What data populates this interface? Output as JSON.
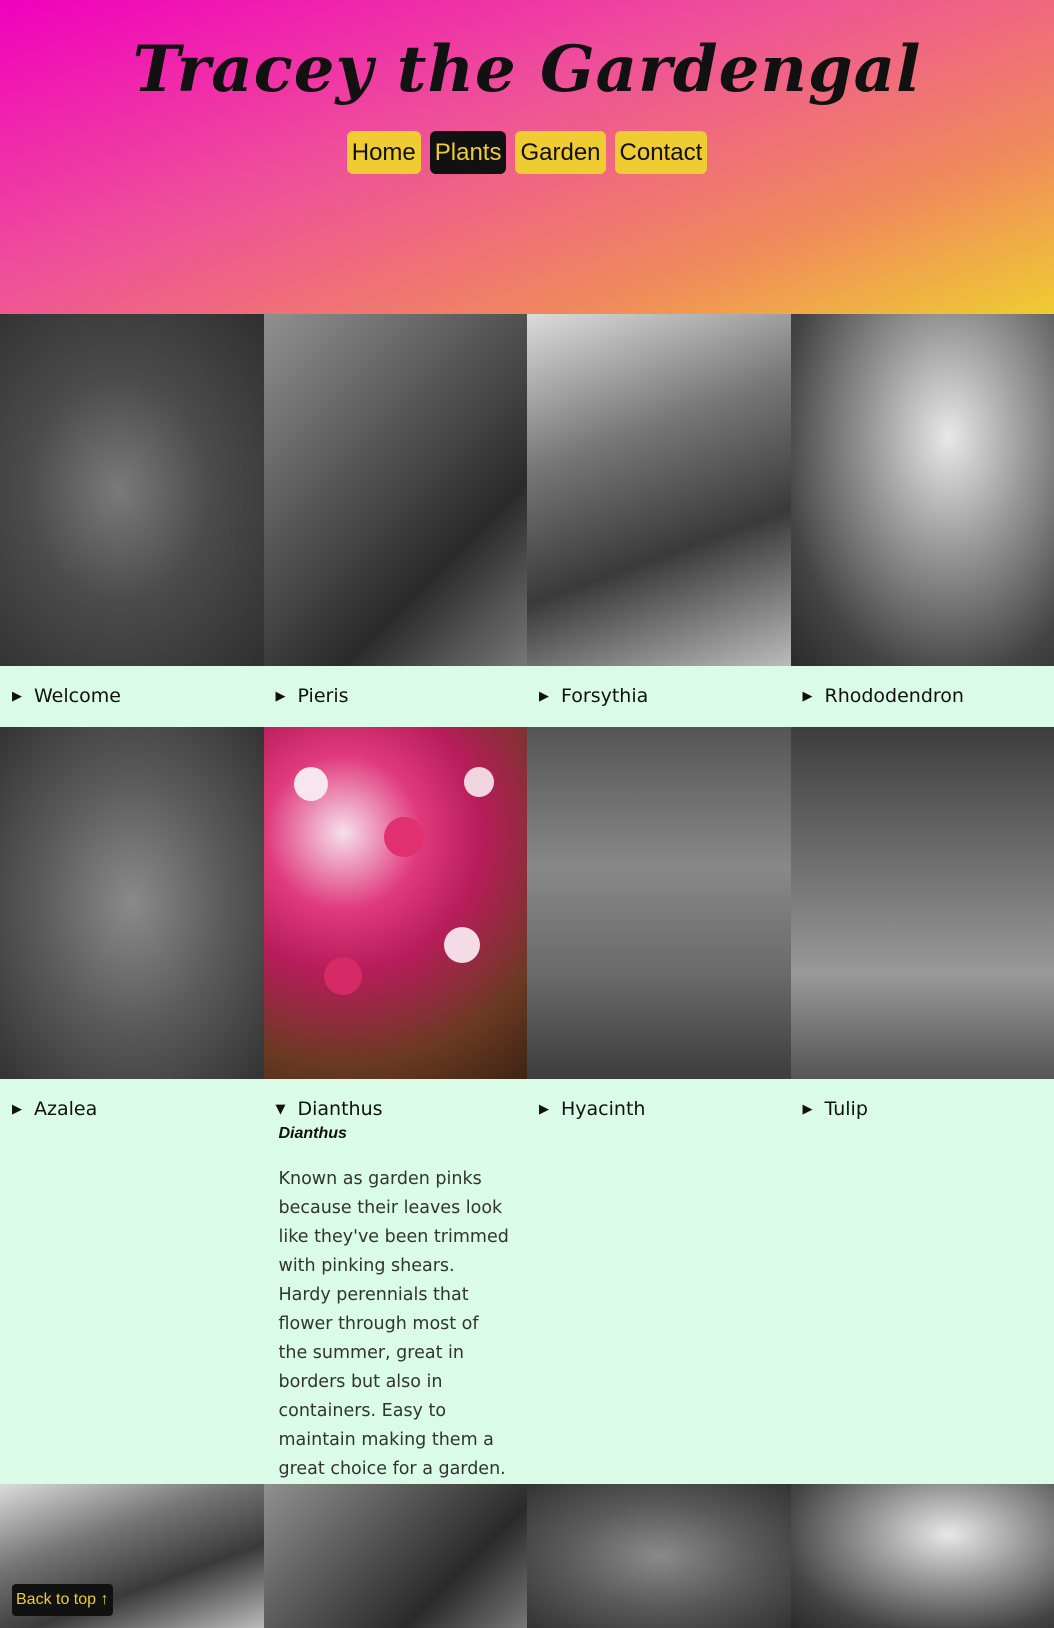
{
  "site": {
    "title": "Tracey the Gardengal"
  },
  "nav": [
    {
      "label": "Home",
      "active": false
    },
    {
      "label": "Plants",
      "active": true
    },
    {
      "label": "Garden",
      "active": false
    },
    {
      "label": "Contact",
      "active": false
    }
  ],
  "cards": [
    {
      "label": "Welcome",
      "expanded": false
    },
    {
      "label": "Pieris",
      "expanded": false
    },
    {
      "label": "Forsythia",
      "expanded": false
    },
    {
      "label": "Rhododendron",
      "expanded": false
    },
    {
      "label": "Azalea",
      "expanded": false
    },
    {
      "label": "Dianthus",
      "expanded": true,
      "latin_name": "Dianthus",
      "description": "Known as garden pinks because their leaves look like they've been trimmed with pinking shears. Hardy perennials that flower through most of the summer, great in borders but also in containers. Easy to maintain making them a great choice for a garden."
    },
    {
      "label": "Hyacinth",
      "expanded": false
    },
    {
      "label": "Tulip",
      "expanded": false
    }
  ],
  "icons": {
    "collapsed": "triangle-right-icon",
    "expanded": "triangle-down-icon"
  },
  "back_to_top": "Back to top ↑",
  "colors": {
    "accent": "#efcc32",
    "dark": "#111111",
    "card_bg": "#d9fbe7",
    "gradient_start": "#f000bd",
    "gradient_end": "#efcc32"
  }
}
